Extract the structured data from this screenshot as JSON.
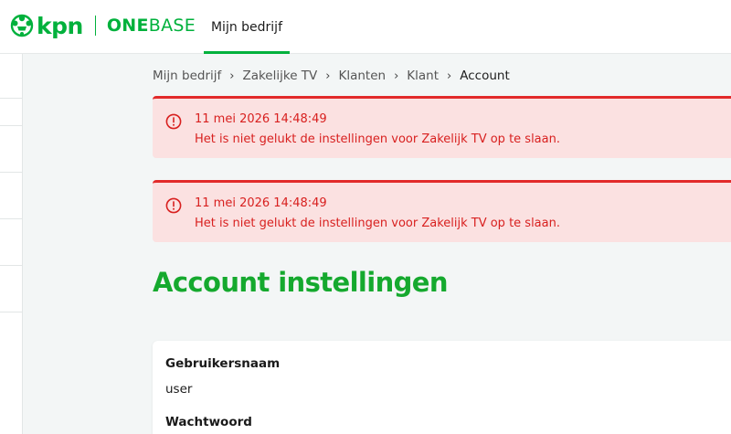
{
  "header": {
    "brand": "kpn",
    "product": {
      "one": "ONE",
      "base": "BASE"
    },
    "nav_tab": "Mijn bedrijf"
  },
  "breadcrumb": [
    "Mijn bedrijf",
    "Zakelijke TV",
    "Klanten",
    "Klant",
    "Account"
  ],
  "alerts": [
    {
      "timestamp": "11 mei 2026 14:48:49",
      "message": "Het is niet gelukt de instellingen voor Zakelijk TV op te slaan."
    },
    {
      "timestamp": "11 mei 2026 14:48:49",
      "message": "Het is niet gelukt de instellingen voor Zakelijk TV op te slaan."
    }
  ],
  "page_title": "Account instellingen",
  "account": {
    "username_label": "Gebruikersnaam",
    "username_value": "user",
    "password_label": "Wachtwoord"
  },
  "colors": {
    "brand_green": "#00b13c",
    "title_green": "#15a92e",
    "error_red": "#d8201f",
    "error_bg": "#fbe1e1"
  }
}
